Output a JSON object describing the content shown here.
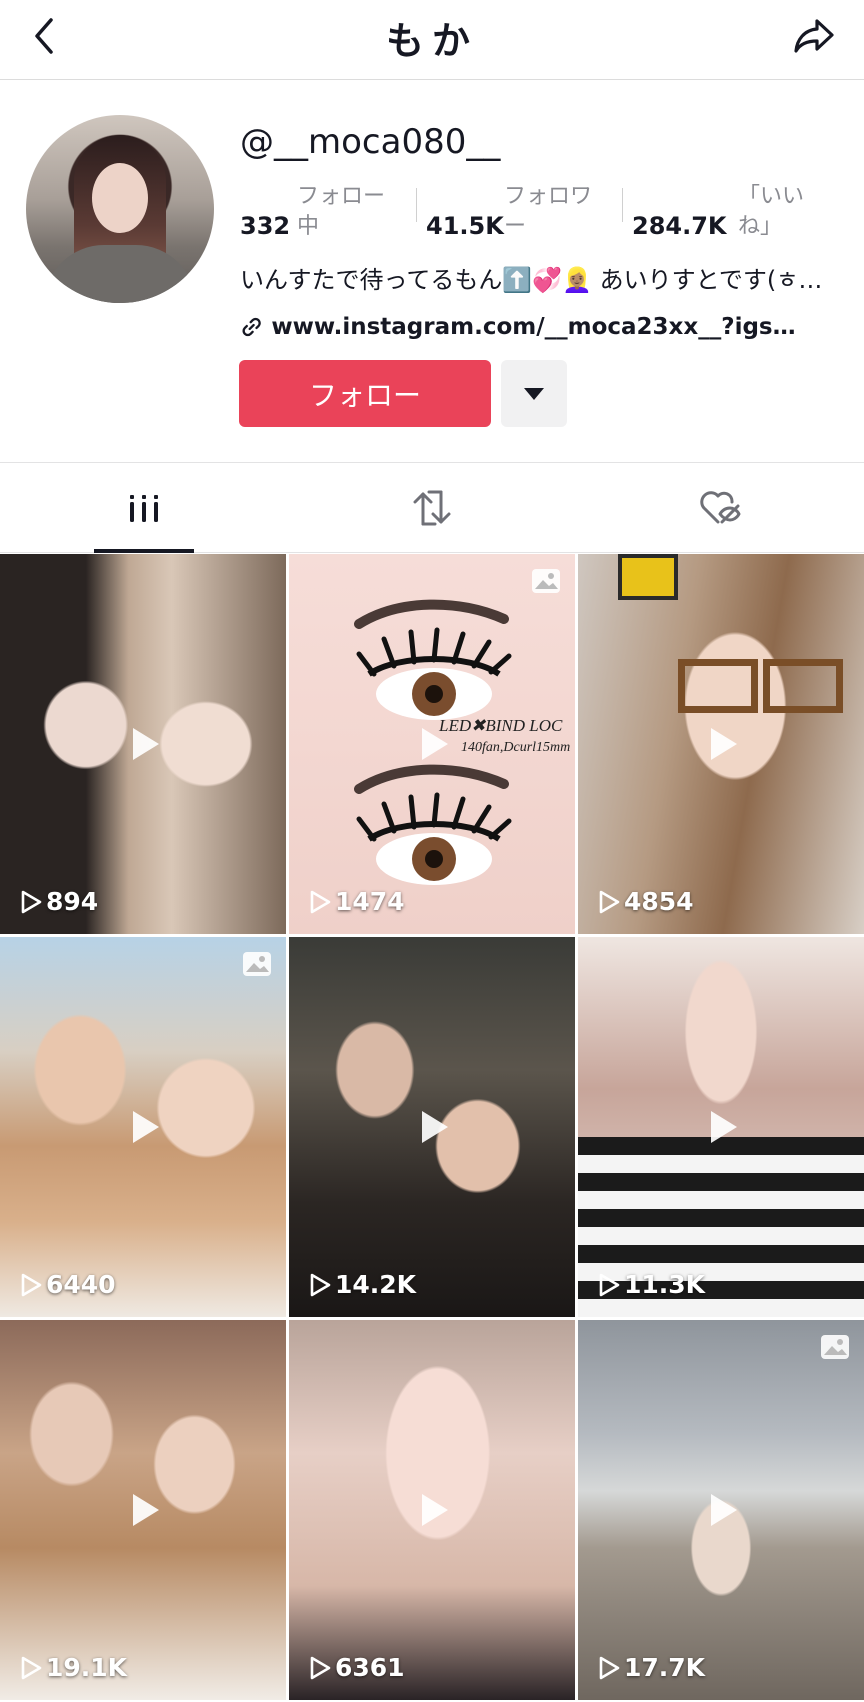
{
  "header": {
    "title": "もか"
  },
  "profile": {
    "username": "@__moca080__",
    "stats": [
      {
        "value": "332",
        "label": "フォロー\n中"
      },
      {
        "value": "41.5K",
        "label": "フォロワ\nー"
      },
      {
        "value": "284.7K",
        "label": "「いい\nね」"
      }
    ],
    "bio": "いんすたで待ってるもん⬆️💞👱🏽‍♀️ あいりすとです(ㅎ…",
    "link": "www.instagram.com/__moca23xx__?igsh...",
    "follow_label": "フォロー"
  },
  "tabs": [
    {
      "name": "videos",
      "icon": "grid-icon",
      "active": true
    },
    {
      "name": "reposts",
      "icon": "repost-icon",
      "active": false
    },
    {
      "name": "liked",
      "icon": "liked-hidden-icon",
      "active": false
    }
  ],
  "videos": [
    {
      "views": "894",
      "photo": false
    },
    {
      "views": "1474",
      "photo": true,
      "overlay_text": "LED✖BIND LOC",
      "overlay_sub": "140fan,Dcurl15mm"
    },
    {
      "views": "4854",
      "photo": false
    },
    {
      "views": "6440",
      "photo": true
    },
    {
      "views": "14.2K",
      "photo": false
    },
    {
      "views": "11.3K",
      "photo": false
    },
    {
      "views": "19.1K",
      "photo": false
    },
    {
      "views": "6361",
      "photo": false
    },
    {
      "views": "17.7K",
      "photo": true
    }
  ],
  "colors": {
    "follow": "#ea4359",
    "text": "#161823",
    "muted": "#8a8b91"
  }
}
